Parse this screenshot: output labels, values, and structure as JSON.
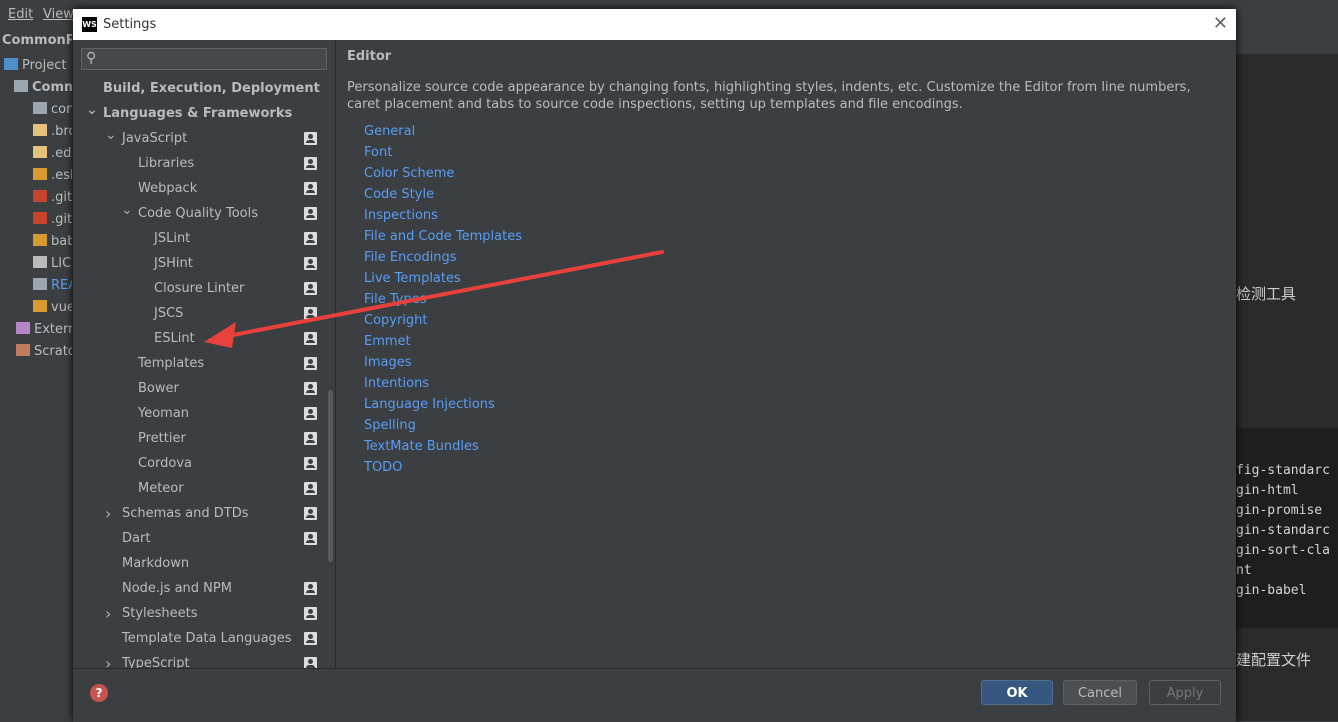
{
  "background": {
    "menu": [
      "Edit",
      "View"
    ],
    "project_name": "CommonPr",
    "project_tab": "Project",
    "tree": [
      {
        "label": "Comm",
        "icon": "folder-icon",
        "color": "#bbbbbb"
      },
      {
        "label": "con",
        "icon": "folder-icon",
        "color": "#bbbbbb"
      },
      {
        "label": ".bro",
        "icon": "settings-file-icon",
        "color": "#bbbbbb"
      },
      {
        "label": ".edi",
        "icon": "settings-file-icon",
        "color": "#bbbbbb"
      },
      {
        "label": ".esli",
        "icon": "js-file-icon",
        "color": "#bbbbbb"
      },
      {
        "label": ".gita",
        "icon": "git-file-icon",
        "color": "#bbbbbb"
      },
      {
        "label": ".giti",
        "icon": "git-file-icon",
        "color": "#bbbbbb"
      },
      {
        "label": "bab",
        "icon": "js-file-icon",
        "color": "#bbbbbb"
      },
      {
        "label": "LICI",
        "icon": "copyright-icon",
        "color": "#bbbbbb"
      },
      {
        "label": "REA",
        "icon": "markdown-file-icon",
        "color": "#589df6"
      },
      {
        "label": "vue",
        "icon": "js-file-icon",
        "color": "#bbbbbb"
      },
      {
        "label": "Extern",
        "icon": "library-icon",
        "color": "#bbbbbb"
      },
      {
        "label": "Scratc",
        "icon": "scratch-icon",
        "color": "#bbbbbb"
      }
    ],
    "right_text_1": "检测工具",
    "right_text_2": "建配置文件",
    "code_lines": [
      "fig-standarc",
      "gin-html",
      "gin-promise",
      "gin-standarc",
      "gin-sort-cla",
      "nt",
      "gin-babel"
    ]
  },
  "dialog": {
    "title": "Settings",
    "logo": "WS",
    "close": "✕",
    "search_placeholder": "",
    "tree": [
      {
        "label": "Build, Execution, Deployment",
        "bold": true
      },
      {
        "label": "Languages & Frameworks",
        "bold": true,
        "expanded": true
      },
      {
        "label": "JavaScript",
        "expanded": true
      },
      {
        "label": "Libraries"
      },
      {
        "label": "Webpack"
      },
      {
        "label": "Code Quality Tools",
        "expanded": true
      },
      {
        "label": "JSLint"
      },
      {
        "label": "JSHint"
      },
      {
        "label": "Closure Linter"
      },
      {
        "label": "JSCS"
      },
      {
        "label": "ESLint"
      },
      {
        "label": "Templates"
      },
      {
        "label": "Bower"
      },
      {
        "label": "Yeoman"
      },
      {
        "label": "Prettier"
      },
      {
        "label": "Cordova"
      },
      {
        "label": "Meteor"
      },
      {
        "label": "Schemas and DTDs",
        "collapsed": true
      },
      {
        "label": "Dart"
      },
      {
        "label": "Markdown"
      },
      {
        "label": "Node.js and NPM"
      },
      {
        "label": "Stylesheets",
        "collapsed": true
      },
      {
        "label": "Template Data Languages"
      },
      {
        "label": "TypeScript",
        "collapsed": true
      }
    ],
    "content": {
      "heading": "Editor",
      "description": "Personalize source code appearance by changing fonts, highlighting styles, indents, etc. Customize the Editor from line numbers, caret placement and tabs to source code inspections, setting up templates and file encodings.",
      "links": [
        "General",
        "Font",
        "Color Scheme",
        "Code Style",
        "Inspections",
        "File and Code Templates",
        "File Encodings",
        "Live Templates",
        "File Types",
        "Copyright",
        "Emmet",
        "Images",
        "Intentions",
        "Language Injections",
        "Spelling",
        "TextMate Bundles",
        "TODO"
      ]
    },
    "buttons": {
      "ok": "OK",
      "cancel": "Cancel",
      "apply": "Apply"
    },
    "help": "?"
  },
  "colors": {
    "accent": "#589df6",
    "ok_button": "#365880",
    "annotation_arrow": "#e8403a"
  }
}
